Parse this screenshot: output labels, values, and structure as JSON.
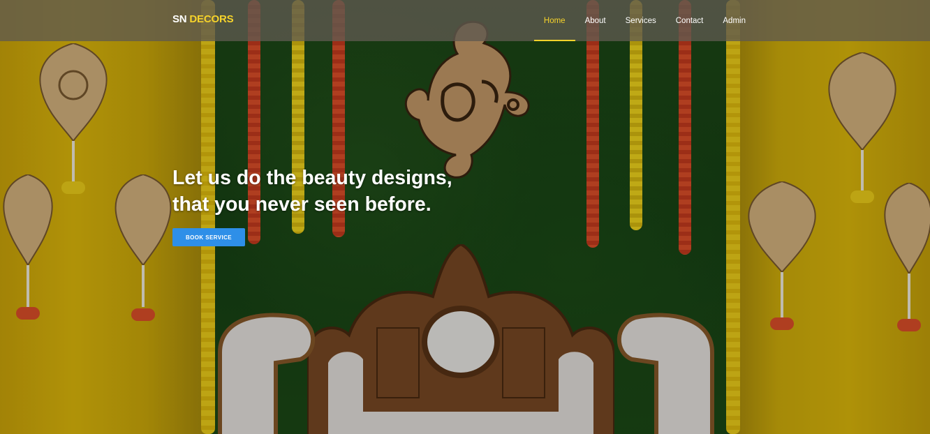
{
  "brand": {
    "name_primary": "SN",
    "name_accent": "DECORS"
  },
  "nav": {
    "items": [
      {
        "label": "Home",
        "active": true
      },
      {
        "label": "About",
        "active": false
      },
      {
        "label": "Services",
        "active": false
      },
      {
        "label": "Contact",
        "active": false
      },
      {
        "label": "Admin",
        "active": false
      }
    ]
  },
  "hero": {
    "headline_line1": "Let us do the beauty designs,",
    "headline_line2": "that you never seen before.",
    "cta_label": "BOOK SERVICE"
  },
  "colors": {
    "accent": "#f6d32b",
    "button": "#2e8fe8",
    "nav_bg": "#5f5a50"
  }
}
